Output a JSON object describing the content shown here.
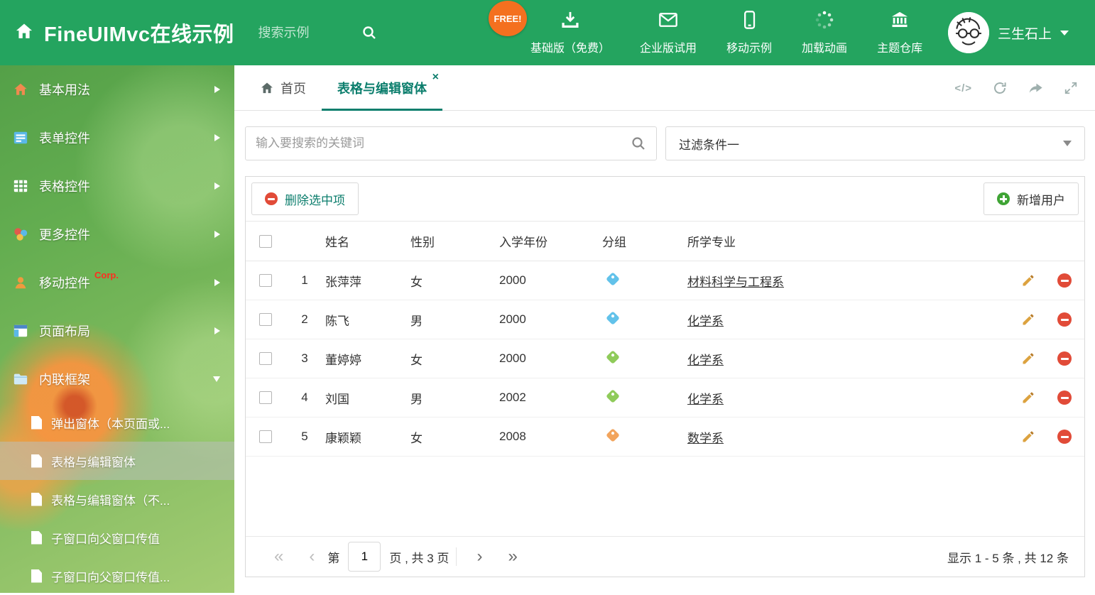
{
  "header": {
    "title": "FineUIMvc在线示例",
    "search_placeholder": "搜索示例",
    "free_badge": "FREE!",
    "nav_items": [
      {
        "label": "基础版（免费）",
        "icon": "download-icon"
      },
      {
        "label": "企业版试用",
        "icon": "envelope-icon"
      },
      {
        "label": "移动示例",
        "icon": "mobile-icon"
      },
      {
        "label": "加载动画",
        "icon": "loading-spinner-icon"
      },
      {
        "label": "主题仓库",
        "icon": "bank-icon"
      }
    ],
    "user_name": "三生石上"
  },
  "sidebar": {
    "items": [
      {
        "label": "基本用法",
        "icon": "home-icon"
      },
      {
        "label": "表单控件",
        "icon": "form-icon"
      },
      {
        "label": "表格控件",
        "icon": "table-icon"
      },
      {
        "label": "更多控件",
        "icon": "more-controls-icon"
      },
      {
        "label": "移动控件",
        "badge": "Corp.",
        "icon": "mobile-controls-icon"
      },
      {
        "label": "页面布局",
        "icon": "layout-icon"
      },
      {
        "label": "内联框架",
        "icon": "iframe-icon"
      }
    ],
    "subitems": [
      {
        "label": "弹出窗体（本页面或..."
      },
      {
        "label": "表格与编辑窗体",
        "active": true
      },
      {
        "label": "表格与编辑窗体（不..."
      },
      {
        "label": "子窗口向父窗口传值"
      },
      {
        "label": "子窗口向父窗口传值..."
      }
    ]
  },
  "tabs": {
    "home": "首页",
    "active": "表格与编辑窗体",
    "close_glyph": "×"
  },
  "filter": {
    "search_placeholder": "输入要搜索的关键词",
    "dropdown_value": "过滤条件一"
  },
  "grid": {
    "delete_button": "删除选中项",
    "add_button": "新增用户",
    "columns": {
      "name": "姓名",
      "gender": "性别",
      "year": "入学年份",
      "group": "分组",
      "major": "所学专业"
    },
    "rows": [
      {
        "index": "1",
        "name": "张萍萍",
        "gender": "女",
        "year": "2000",
        "tag_color": "#62c2ea",
        "major": "材料科学与工程系"
      },
      {
        "index": "2",
        "name": "陈飞",
        "gender": "男",
        "year": "2000",
        "tag_color": "#62c2ea",
        "major": "化学系"
      },
      {
        "index": "3",
        "name": "董婷婷",
        "gender": "女",
        "year": "2000",
        "tag_color": "#8fcb5a",
        "major": "化学系"
      },
      {
        "index": "4",
        "name": "刘国",
        "gender": "男",
        "year": "2002",
        "tag_color": "#8fcb5a",
        "major": "化学系"
      },
      {
        "index": "5",
        "name": "康颖颖",
        "gender": "女",
        "year": "2008",
        "tag_color": "#f2a45c",
        "major": "数学系"
      }
    ]
  },
  "pagination": {
    "first_glyph": "«",
    "prev_glyph": "‹",
    "next_glyph": "›",
    "last_glyph": "»",
    "label_prefix": "第",
    "page_value": "1",
    "label_suffix": "页 , 共 3 页",
    "summary": "显示 1 - 5 条 , 共 12 条"
  },
  "colors": {
    "header_green": "#24a45f",
    "accent_teal": "#0c7e6d",
    "free_badge_orange": "#f4701f",
    "delete_red": "#e14b38",
    "add_green": "#3fa435",
    "edit_yellow": "#dca23f"
  }
}
